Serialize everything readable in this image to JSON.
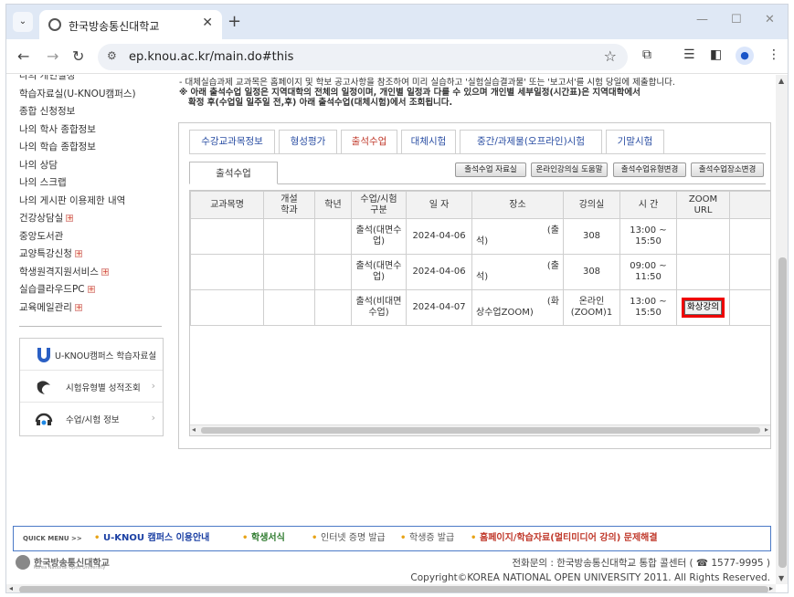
{
  "browser": {
    "tab_title": "한국방송통신대학교",
    "url": "ep.knou.ac.kr/main.do#this",
    "icons": [
      "tab-list-icon",
      "site-favicon",
      "close-tab-icon",
      "new-tab-icon",
      "minimize-icon",
      "maximize-icon",
      "close-window-icon",
      "back-icon",
      "forward-icon",
      "reload-icon",
      "site-settings-icon",
      "bookmark-star-icon",
      "extensions-icon",
      "reading-list-icon",
      "side-panel-icon",
      "profile-icon",
      "more-menu-icon"
    ]
  },
  "sidebar": {
    "items": [
      {
        "label": "나의 개인설정",
        "plus": false
      },
      {
        "label": "학습자료실(U-KNOU캠퍼스)",
        "plus": false
      },
      {
        "label": "종합 신청정보",
        "plus": false
      },
      {
        "label": "나의 학사 종합정보",
        "plus": false
      },
      {
        "label": "나의 학습 종합정보",
        "plus": false
      },
      {
        "label": "나의 상담",
        "plus": false
      },
      {
        "label": "나의 스크랩",
        "plus": false
      },
      {
        "label": "나의 게시판 이용제한 내역",
        "plus": false
      },
      {
        "label": "건강상담실",
        "plus": true
      },
      {
        "label": "중앙도서관",
        "plus": false
      },
      {
        "label": "교양특강신청",
        "plus": true
      },
      {
        "label": "학생원격지원서비스",
        "plus": true
      },
      {
        "label": "실습클라우드PC",
        "plus": true
      },
      {
        "label": "교육메일관리",
        "plus": true
      }
    ],
    "quick": [
      {
        "label": "U-KNOU캠퍼스 학습자료실",
        "icon": "u-knou-logo-icon"
      },
      {
        "label": "시험유형별 성적조회",
        "icon": "exam-grade-icon"
      },
      {
        "label": "수업/시험 정보",
        "icon": "class-exam-info-icon"
      }
    ]
  },
  "notice": {
    "line1": "- 대체실습과제 교과목은 홈페이지 및 학보 공고사항을 참조하여 미리 실습하고 '실험실습결과물' 또는 '보고서'를 시험 당일에 제출합니다.",
    "line2": "※ 아래 출석수업 일정은 지역대학의 전체의 일정이며, 개인별 일정과 다를 수 있으며 개인별 세부일정(시간표)은 지역대학에서",
    "line3": "확정 후(수업일 일주일 전,후) 아래 출석수업(대체시험)에서 조회됩니다."
  },
  "tabs": [
    "수강교과목정보",
    "형성평가",
    "출석수업",
    "대체시험",
    "중간/과제물(오프라인)시험",
    "기말시험"
  ],
  "active_tab": "출석수업",
  "subtab": "출석수업",
  "buttons": [
    "출석수업 자료실",
    "온라인강의실 도움말",
    "출석수업유형변경",
    "출석수업장소변경"
  ],
  "table": {
    "headers": [
      "교과목명",
      "개설\n학과",
      "학년",
      "수업/시험\n구분",
      "일 자",
      "장소",
      "강의실",
      "시 간",
      "ZOOM\nURL"
    ],
    "rows": [
      {
        "course": "",
        "dept": "",
        "year": "",
        "type": "출석(대면수업)",
        "date": "2024-04-06",
        "place_a": "(출",
        "place_b": "석)",
        "room": "308",
        "time": "13:00 ~ 15:50",
        "zoom": ""
      },
      {
        "course": "",
        "dept": "",
        "year": "",
        "type": "출석(대면수업)",
        "date": "2024-04-06",
        "place_a": "(출",
        "place_b": "석)",
        "room": "308",
        "time": "09:00 ~ 11:50",
        "zoom": ""
      },
      {
        "course": "",
        "dept": "",
        "year": "",
        "type": "출석(비대면수업)",
        "date": "2024-04-07",
        "place_a": "(화",
        "place_b": "상수업ZOOM)",
        "room": "온라인(ZOOM)1",
        "time": "13:00 ~ 15:50",
        "zoom": "화상강의"
      }
    ]
  },
  "footer": {
    "quick_menu_label": "QUICK MENU >>",
    "links": [
      {
        "text": "U-KNOU 캠퍼스 이용안내",
        "color": "#1a3fa3",
        "bold": true
      },
      {
        "text": "학생서식",
        "color": "#2d7a2d",
        "bold": true
      },
      {
        "text": "인터넷 증명 발급",
        "color": "#555555",
        "bold": false
      },
      {
        "text": "학생증 발급",
        "color": "#555555",
        "bold": false
      },
      {
        "text": "홈페이지/학습자료(멀티미디어 강의) 문제해결",
        "color": "#c0392b",
        "bold": true
      }
    ],
    "logo_name": "한국방송통신대학교",
    "logo_en": "Korea National Open University",
    "contact": "전화문의 : 한국방송통신대학교 통합 콜센터 ( ☎ 1577-9995 )",
    "copyright": "Copyright©KOREA NATIONAL OPEN UNIVERSITY 2011. All Rights Reserved."
  }
}
